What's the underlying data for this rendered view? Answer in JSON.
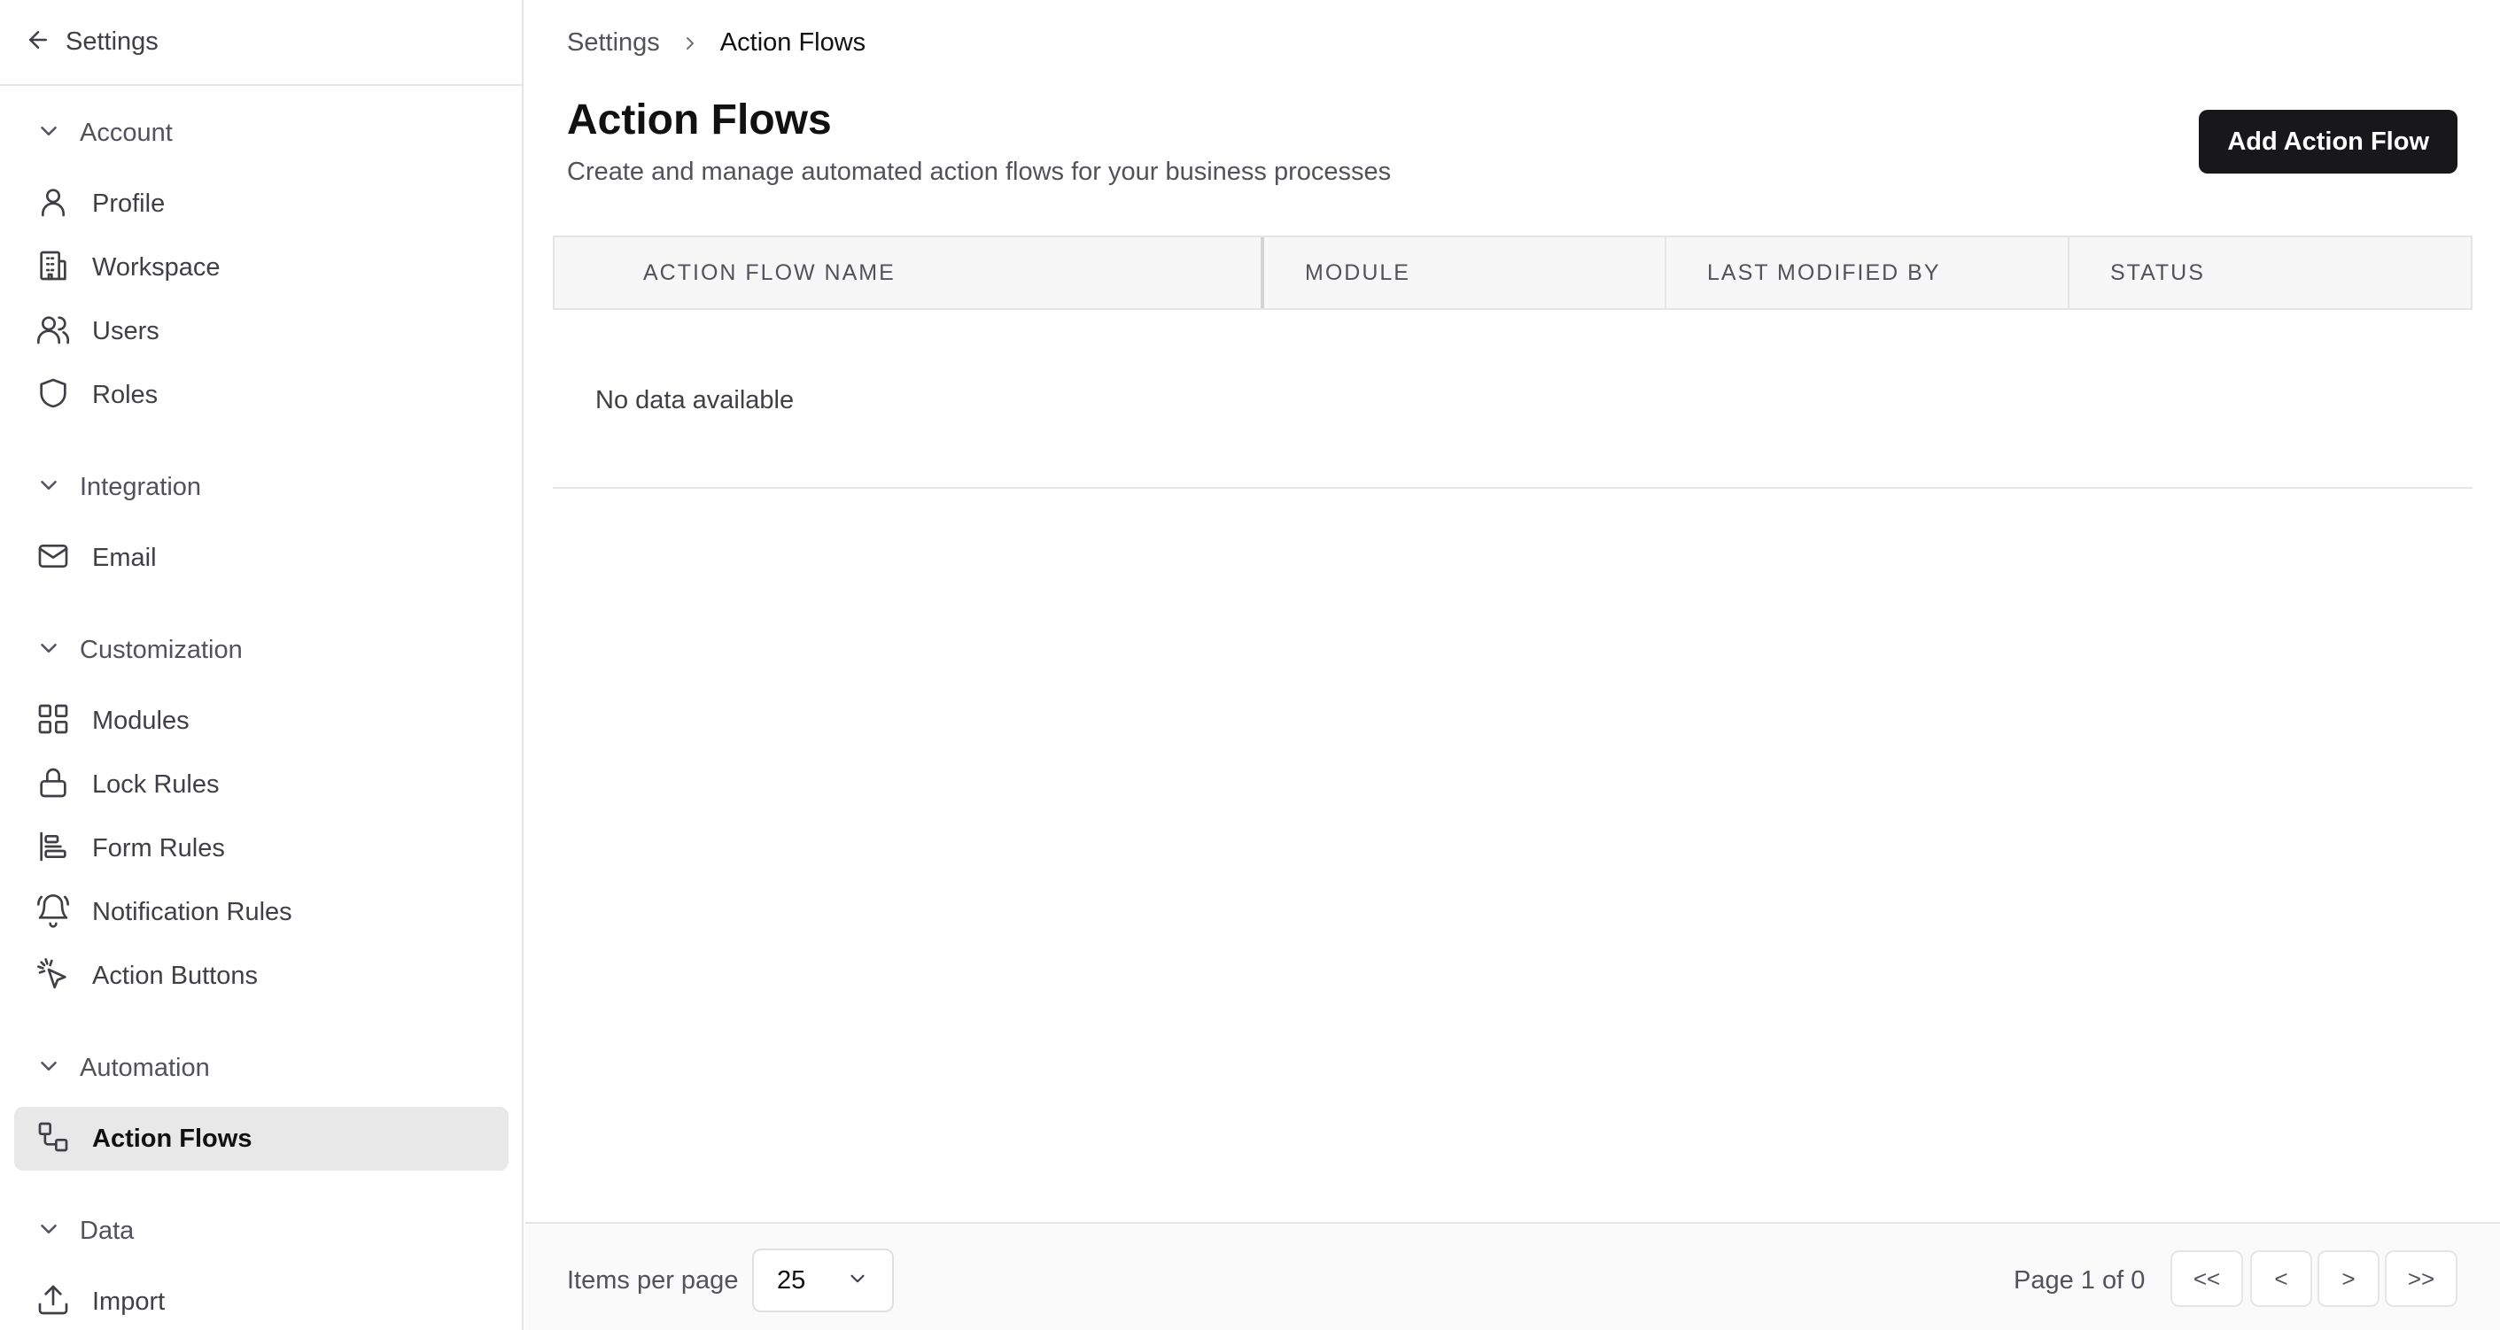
{
  "sidebar": {
    "back_label": "Settings",
    "sections": [
      {
        "title": "Account",
        "items": [
          {
            "label": "Profile",
            "icon": "user-icon"
          },
          {
            "label": "Workspace",
            "icon": "building-icon"
          },
          {
            "label": "Users",
            "icon": "users-icon"
          },
          {
            "label": "Roles",
            "icon": "shield-icon"
          }
        ]
      },
      {
        "title": "Integration",
        "items": [
          {
            "label": "Email",
            "icon": "mail-icon"
          }
        ]
      },
      {
        "title": "Customization",
        "items": [
          {
            "label": "Modules",
            "icon": "grid-icon"
          },
          {
            "label": "Lock Rules",
            "icon": "lock-icon"
          },
          {
            "label": "Form Rules",
            "icon": "align-left-icon"
          },
          {
            "label": "Notification Rules",
            "icon": "bell-icon"
          },
          {
            "label": "Action Buttons",
            "icon": "pointer-click-icon"
          }
        ]
      },
      {
        "title": "Automation",
        "items": [
          {
            "label": "Action Flows",
            "icon": "workflow-icon",
            "active": true
          }
        ]
      },
      {
        "title": "Data",
        "items": [
          {
            "label": "Import",
            "icon": "upload-icon"
          }
        ]
      }
    ]
  },
  "breadcrumb": {
    "parent": "Settings",
    "current": "Action Flows"
  },
  "page": {
    "title": "Action Flows",
    "subtitle": "Create and manage automated action flows for your business processes",
    "add_button": "Add Action Flow"
  },
  "table": {
    "columns": [
      "ACTION FLOW NAME",
      "MODULE",
      "LAST MODIFIED BY",
      "STATUS"
    ],
    "rows": [],
    "empty_text": "No data available"
  },
  "pagination": {
    "items_per_page_label": "Items per page",
    "items_per_page": "25",
    "page_info": "Page 1 of 0",
    "first": "<<",
    "prev": "<",
    "next": ">",
    "last": ">>"
  },
  "colors": {
    "accent": "#18181b",
    "active_bg": "#e8e8e8",
    "border": "#e5e5e5"
  }
}
